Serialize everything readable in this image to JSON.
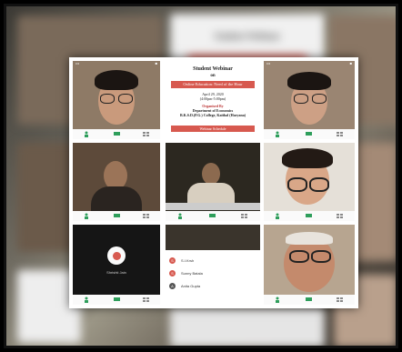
{
  "webinar": {
    "heading": "Student Webinar",
    "on": "on",
    "topic": "Online Education: Need of the Hour",
    "date": "April 29, 2020",
    "time": "(4:00pm-5:00pm)",
    "organized_by": "Organised By",
    "dept": "Department of Economics",
    "college": "B.K.S.D.(P.G.) College, Kaithal (Haryana)",
    "schedule_button": "Webinar Schedule",
    "blurred_heading": "Student Webinar"
  },
  "participants_list": [
    {
      "name": "S.I.Krsh",
      "color": "#d7594f",
      "initial": "S"
    },
    {
      "name": "Sunny Batala",
      "color": "#d7594f",
      "initial": "S"
    },
    {
      "name": "Anita Gupta",
      "color": "#555555",
      "initial": "A"
    }
  ],
  "meeting_tile": {
    "name_label": "Shrishti Jain"
  },
  "colors": {
    "accent_red": "#d7594f",
    "meet_green": "#2e9e5b",
    "tile_bar": "#fafafa"
  }
}
